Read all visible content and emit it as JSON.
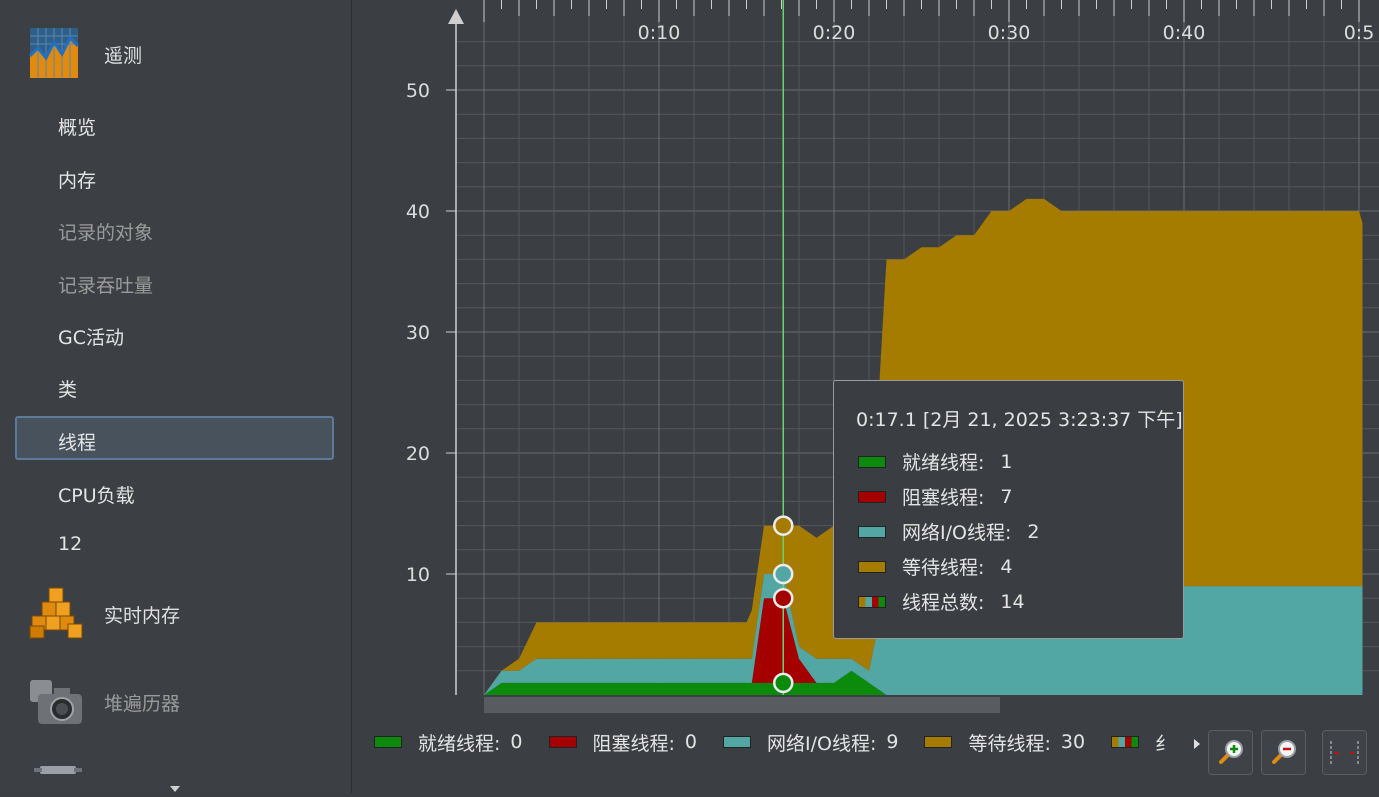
{
  "sidebar": {
    "sections": [
      {
        "label": "遥测",
        "icon": "telemetry-icon"
      },
      {
        "label": "实时内存",
        "icon": "live-memory-icon"
      },
      {
        "label": "堆遍历器",
        "icon": "heap-walker-camera-icon"
      }
    ],
    "items": [
      {
        "label": "概览",
        "enabled": true
      },
      {
        "label": "内存",
        "enabled": true
      },
      {
        "label": "记录的对象",
        "enabled": false
      },
      {
        "label": "记录吞吐量",
        "enabled": false
      },
      {
        "label": "GC活动",
        "enabled": true
      },
      {
        "label": "类",
        "enabled": true
      },
      {
        "label": "线程",
        "enabled": true,
        "selected": true
      },
      {
        "label": "CPU负载",
        "enabled": true
      },
      {
        "label": "12",
        "enabled": true
      }
    ]
  },
  "tooltip": {
    "title": "0:17.1 [2月 21, 2025 3:23:37 下午]",
    "rows": [
      {
        "label": "就绪线程:",
        "value": "1"
      },
      {
        "label": "阻塞线程:",
        "value": "7"
      },
      {
        "label": "网络I/O线程:",
        "value": "2"
      },
      {
        "label": "等待线程:",
        "value": "4"
      },
      {
        "label": "线程总数:",
        "value": "14"
      }
    ]
  },
  "legend": [
    {
      "label": "就绪线程:",
      "value": "0"
    },
    {
      "label": "阻塞线程:",
      "value": "0"
    },
    {
      "label": "网络I/O线程:",
      "value": "9"
    },
    {
      "label": "等待线程:",
      "value": "30"
    },
    {
      "label": "纟",
      "value": ""
    }
  ],
  "toolbar": {
    "zoom_in": "zoom-in-icon",
    "zoom_out": "zoom-out-icon",
    "fit": "fit-icon"
  },
  "chart_data": {
    "type": "area",
    "stacked": true,
    "colors": {
      "runnable": "#0c8a0c",
      "blocked": "#a50000",
      "netio": "#52a7a5",
      "waiting": "#a67c00",
      "bg": "#3b3e42",
      "grid": "#55585c"
    },
    "x_ticks": [
      "0:10",
      "0:20",
      "0:30",
      "0:40",
      "0:5"
    ],
    "y_ticks": [
      10,
      20,
      30,
      40,
      50
    ],
    "xlim": [
      0,
      50
    ],
    "ylim": [
      0,
      55
    ],
    "cursor_x": 17.1,
    "x": [
      0,
      1,
      2,
      3,
      15,
      15.3,
      16,
      17.1,
      18,
      19,
      20,
      21,
      22,
      23,
      24,
      25,
      26,
      27,
      28,
      29,
      30,
      31,
      32,
      33,
      50,
      50.2
    ],
    "series": [
      {
        "key": "runnable",
        "name": "就绪线程",
        "values": [
          0,
          1,
          1,
          1,
          1,
          1,
          1,
          1,
          1,
          1,
          1,
          2,
          1,
          0,
          0,
          0,
          0,
          0,
          0,
          0,
          0,
          0,
          0,
          0,
          0,
          0
        ]
      },
      {
        "key": "blocked",
        "name": "阻塞线程",
        "values": [
          0,
          0,
          0,
          0,
          0,
          0,
          7,
          7,
          2,
          0,
          0,
          0,
          0,
          0,
          0,
          0,
          0,
          0,
          0,
          0,
          0,
          0,
          0,
          0,
          0,
          0
        ]
      },
      {
        "key": "netio",
        "name": "网络I/O线程",
        "values": [
          0,
          1,
          1,
          2,
          2,
          2,
          2,
          2,
          1,
          2,
          2,
          1,
          1,
          9,
          9,
          9,
          9,
          9,
          9,
          9,
          9,
          9,
          9,
          9,
          9,
          9
        ]
      },
      {
        "key": "waiting",
        "name": "等待线程",
        "values": [
          0,
          0,
          1,
          3,
          3,
          4,
          4,
          4,
          10,
          10,
          11,
          10,
          9,
          27,
          27,
          28,
          28,
          29,
          29,
          31,
          31,
          32,
          32,
          31,
          31,
          30
        ]
      }
    ]
  }
}
